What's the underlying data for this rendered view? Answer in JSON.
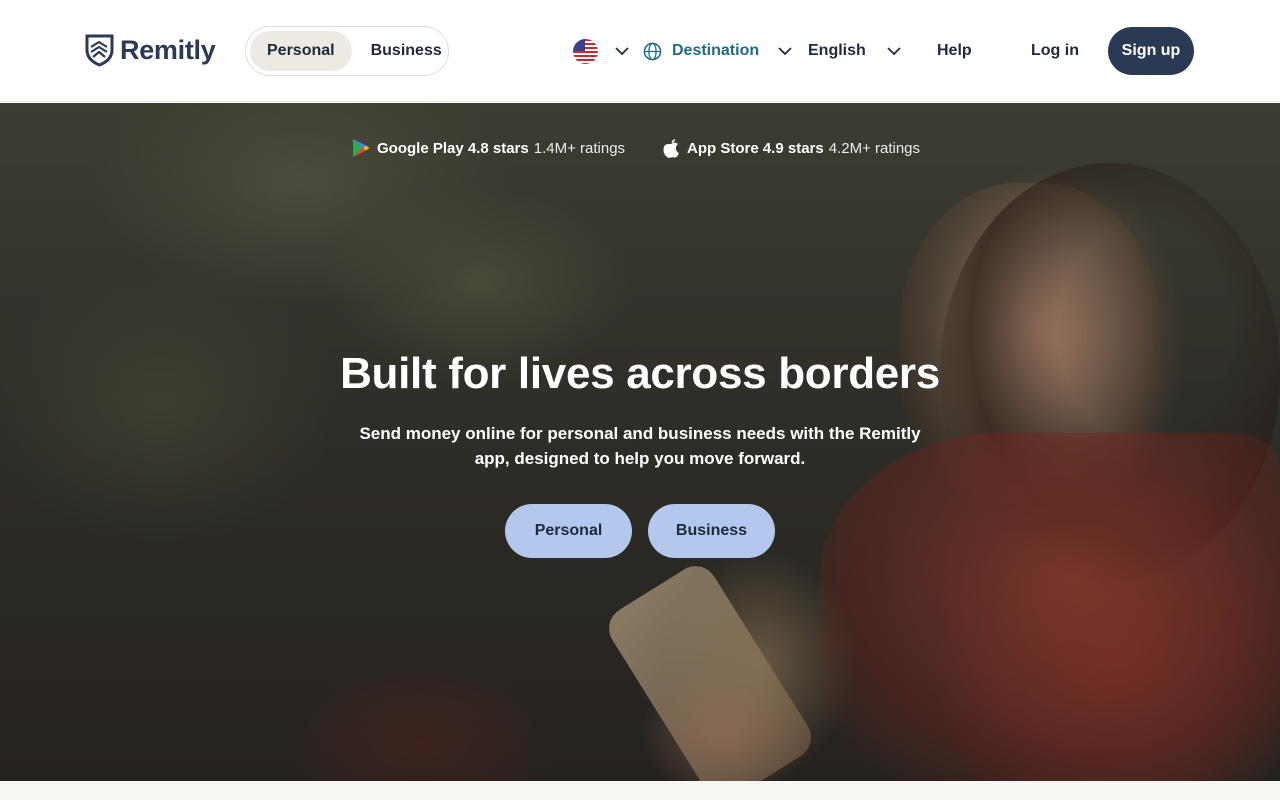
{
  "header": {
    "brand": "Remitly",
    "audience_toggle": [
      "Personal",
      "Business"
    ],
    "active_audience": "Personal",
    "country_flag": "us-flag-icon",
    "destination_label": "Destination",
    "language_label": "English",
    "help_label": "Help",
    "login_label": "Log in",
    "signup_label": "Sign up"
  },
  "ratings": {
    "google": {
      "store": "Google Play 4.8 stars",
      "count": "1.4M+ ratings",
      "icon": "google-play-icon"
    },
    "apple": {
      "store": "App Store 4.9 stars",
      "count": "4.2M+ ratings",
      "icon": "apple-icon"
    }
  },
  "hero": {
    "title": "Built for lives across borders",
    "subtitle": "Send money online for personal and business needs with the Remitly app, designed to help you move forward.",
    "personal_button": "Personal",
    "business_button": "Business"
  },
  "colors": {
    "brand_navy": "#2a3a55",
    "destination_teal": "#1e6c86",
    "hero_button": "#b4c7ec",
    "toggle_active": "#ede9e3"
  }
}
